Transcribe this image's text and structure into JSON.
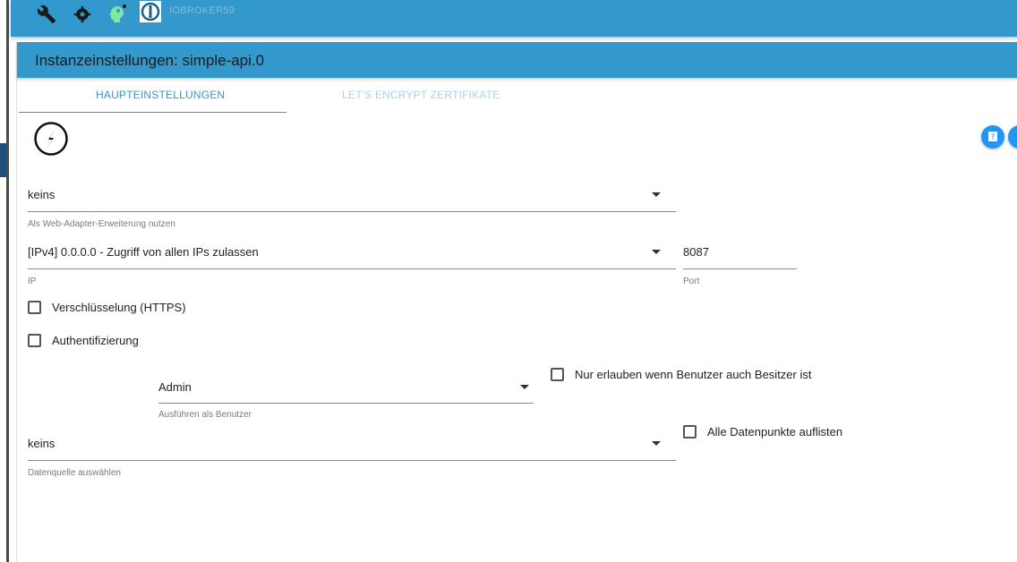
{
  "toolbar": {
    "icons": [
      "wrench-icon",
      "gear-icon",
      "head-icon",
      "iobroker-logo-icon"
    ],
    "hostname": "IOBROKER59"
  },
  "panel": {
    "title": "Instanzeinstellungen: simple-api.0"
  },
  "tabs": [
    {
      "label": "HAUPTEINSTELLUNGEN",
      "active": true
    },
    {
      "label": "LET'S ENCRYPT ZERTIFIKATE",
      "active": false
    }
  ],
  "form": {
    "web_adapter": {
      "value": "keins",
      "helper": "Als Web-Adapter-Erweiterung nutzen"
    },
    "ip": {
      "value": "[IPv4] 0.0.0.0 - Zugriff von allen IPs zulassen",
      "helper": "IP"
    },
    "port": {
      "value": "8087",
      "helper": "Port"
    },
    "https": {
      "label": "Verschlüsselung (HTTPS)",
      "checked": false
    },
    "auth": {
      "label": "Authentifizierung",
      "checked": false
    },
    "run_as": {
      "value": "Admin",
      "helper": "Ausführen als Benutzer"
    },
    "owner_only": {
      "label": "Nur erlauben wenn Benutzer auch Besitzer ist",
      "checked": false
    },
    "datasource": {
      "value": "keins",
      "helper": "Datenquelle auswählen"
    },
    "list_all": {
      "label": "Alle Datenpunkte auflisten",
      "checked": false
    }
  },
  "colors": {
    "primary": "#3399cc",
    "help_button": "#2196f3"
  }
}
